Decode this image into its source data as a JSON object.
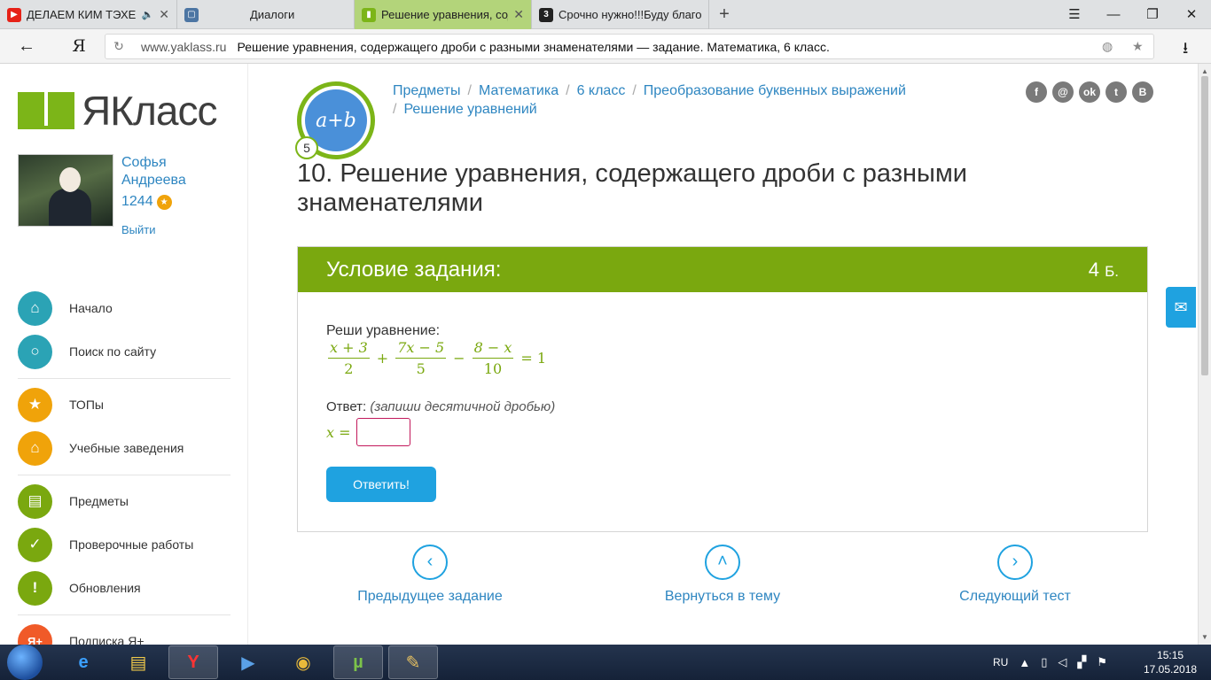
{
  "browser": {
    "tabs": [
      {
        "title": "ДЕЛАЕМ КИМ ТЭХЕН",
        "favicon": "youtube-icon",
        "color": "#e62117"
      },
      {
        "title": "Диалоги",
        "favicon": "vk-icon",
        "color": "#4c75a3"
      },
      {
        "title": "Решение уравнения, сод",
        "favicon": "yaklass-icon",
        "color": "#7cb518"
      },
      {
        "title": "Срочно нужно!!!Буду благо",
        "favicon": "znanija-icon",
        "color": "#222222"
      }
    ],
    "new_tab": "+",
    "win_controls": [
      "☰",
      "—",
      "❐",
      "✕"
    ],
    "back": "←",
    "home": "Я",
    "url_domain": "www.yaklass.ru",
    "page_title": "Решение уравнения, содержащего дроби с разными знаменателями — задание. Математика, 6 класс.",
    "reload": "↻",
    "download": "⭳"
  },
  "sidebar": {
    "logo_text": "ЯКласс",
    "user_name": "Софья Андреева",
    "user_points": "1244",
    "logout": "Выйти",
    "menu": [
      {
        "label": "Начало",
        "icon": "home-icon",
        "color": "#2ba3b5",
        "glyph": "⌂"
      },
      {
        "label": "Поиск по сайту",
        "icon": "search-icon",
        "color": "#2ba3b5",
        "glyph": "⌕"
      },
      {
        "label": "ТОПы",
        "icon": "star-icon",
        "color": "#f0a30a",
        "glyph": "★"
      },
      {
        "label": "Учебные заведения",
        "icon": "institution-icon",
        "color": "#f0a30a",
        "glyph": "⌂"
      },
      {
        "label": "Предметы",
        "icon": "book-icon",
        "color": "#7aa80f",
        "glyph": "▤"
      },
      {
        "label": "Проверочные работы",
        "icon": "check-icon",
        "color": "#7aa80f",
        "glyph": "✓"
      },
      {
        "label": "Обновления",
        "icon": "exclamation-icon",
        "color": "#7aa80f",
        "glyph": "!"
      },
      {
        "label": "Подписка Я+",
        "icon": "ya-plus-icon",
        "color": "#f05a28",
        "glyph": "Я+"
      }
    ]
  },
  "main": {
    "topic_badge": "a+b",
    "topic_number": "5",
    "breadcrumb": [
      "Предметы",
      "Математика",
      "6 класс",
      "Преобразование буквенных выражений",
      "Решение уравнений"
    ],
    "social": [
      "f",
      "@",
      "ok",
      "t",
      "B"
    ],
    "title": "10. Решение уравнения, содержащего дроби с разными знаменателями",
    "task": {
      "header": "Условие задания:",
      "points": "4",
      "points_unit": "Б.",
      "condition": "Реши уравнение:",
      "equation": {
        "f1_num": "x + 3",
        "f1_den": "2",
        "op1": "+",
        "f2_num": "7x − 5",
        "f2_den": "5",
        "op2": "−",
        "f3_num": "8 − x",
        "f3_den": "10",
        "rhs": "= 1"
      },
      "answer_label": "Ответ:",
      "answer_hint": "(запиши десятичной дробью)",
      "answer_var": "x",
      "answer_eq": "=",
      "answer_value": "",
      "submit": "Ответить!"
    },
    "nav": {
      "prev": "Предыдущее задание",
      "back": "Вернуться в тему",
      "next": "Следующий тест"
    }
  },
  "taskbar": {
    "lang": "RU",
    "time": "15:15",
    "date": "17.05.2018"
  }
}
